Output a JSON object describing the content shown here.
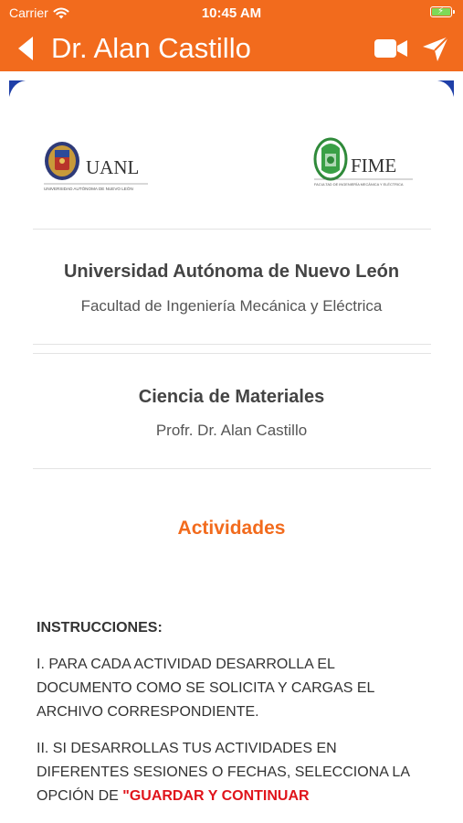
{
  "status_bar": {
    "carrier": "Carrier",
    "time": "10:45 AM",
    "wifi_icon": "wifi-icon",
    "battery_icon": "battery-charging-icon"
  },
  "nav": {
    "title": "Dr. Alan Castillo",
    "back_icon": "back-arrow-icon",
    "video_icon": "video-call-icon",
    "send_icon": "send-icon"
  },
  "logos": {
    "uanl": {
      "name": "UANL",
      "tagline": "UNIVERSIDAD AUTÓNOMA DE NUEVO LEÓN"
    },
    "fime": {
      "name": "FIME",
      "tagline": "FACULTAD DE INGENIERÍA MECÁNICA Y ELÉCTRICA"
    }
  },
  "university": {
    "title": "Universidad Autónoma de Nuevo León",
    "faculty": "Facultad de Ingeniería Mecánica y Eléctrica"
  },
  "course": {
    "title": "Ciencia de Materiales",
    "professor": "Profr. Dr. Alan Castillo"
  },
  "section": {
    "title": "Actividades"
  },
  "instructions": {
    "heading": "INSTRUCCIONES:",
    "item1": "I. PARA CADA ACTIVIDAD DESARROLLA EL DOCUMENTO COMO SE SOLICITA Y CARGAS EL ARCHIVO CORRESPONDIENTE.",
    "item2_prefix": "II. SI DESARROLLAS TUS ACTIVIDADES EN DIFERENTES SESIONES O FECHAS, SELECCIONA LA OPCIÓN  DE ",
    "item2_highlight": "\"GUARDAR Y CONTINUAR"
  },
  "colors": {
    "brand": "#f26b1d",
    "accent_red": "#e0141b",
    "corner_blue": "#1f3fa8"
  }
}
